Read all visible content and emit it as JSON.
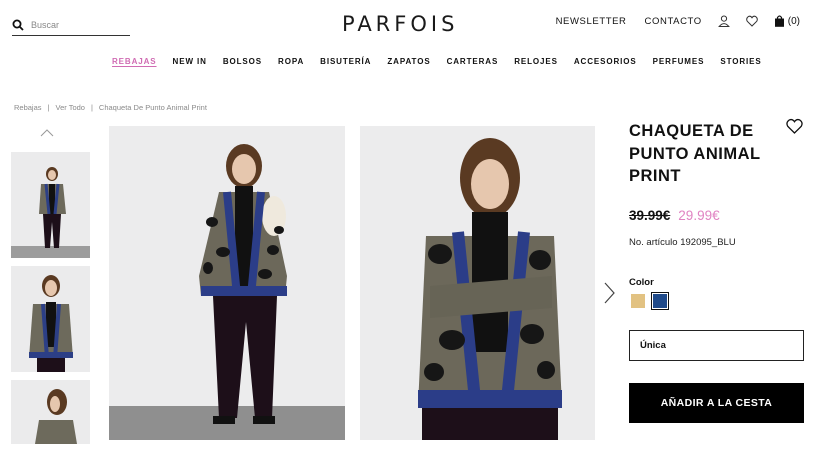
{
  "header": {
    "search_placeholder": "Buscar",
    "logo": "PARFOIS",
    "newsletter": "NEWSLETTER",
    "contact": "CONTACTO",
    "cart_count": "(0)",
    "icons": [
      "search-icon",
      "user-icon",
      "heart-icon",
      "bag-icon"
    ]
  },
  "nav": {
    "items": [
      "REBAJAS",
      "NEW IN",
      "BOLSOS",
      "ROPA",
      "BISUTERÍA",
      "ZAPATOS",
      "CARTERAS",
      "RELOJES",
      "ACCESORIOS",
      "PERFUMES",
      "STORIES"
    ],
    "highlight_color": "#d06cb3"
  },
  "breadcrumb": {
    "items": [
      "Rebajas",
      "Ver Todo",
      "Chaqueta De Punto Animal Print"
    ],
    "separator": "|"
  },
  "product": {
    "title": "CHAQUETA DE PUNTO ANIMAL PRINT",
    "old_price": "39.99€",
    "new_price": "29.99€",
    "sale_color": "#e083c2",
    "article": "No. artículo 192095_BLU",
    "color_label": "Color",
    "colors": [
      "#e2c282",
      "#1f4a8a"
    ],
    "size": "Única",
    "add_to_cart": "AÑADIR A LA CESTA"
  }
}
